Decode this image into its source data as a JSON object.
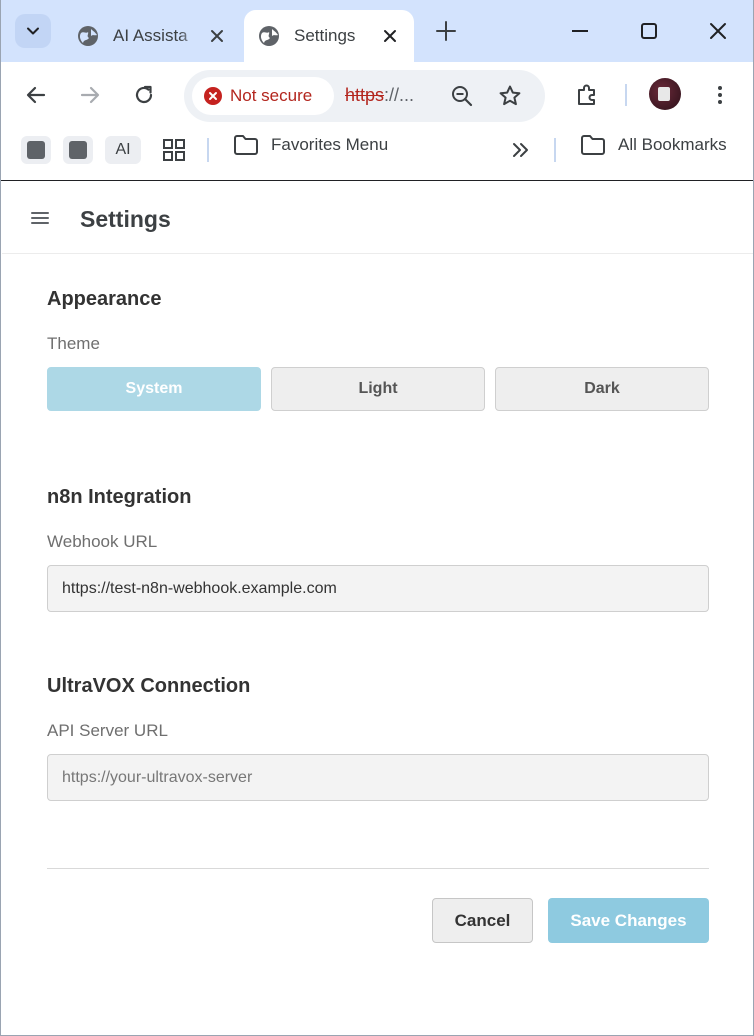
{
  "browser": {
    "tabs": [
      {
        "title": "AI Assista",
        "active": false
      },
      {
        "title": "Settings",
        "active": true
      }
    ],
    "security_label": "Not secure",
    "url_scheme": "https",
    "url_rest": "://...",
    "bookmarks": {
      "chip_ai_label": "AI",
      "favorites_label": "Favorites Menu",
      "all_bookmarks_label": "All Bookmarks"
    },
    "icons": [
      "tab-search-icon",
      "globe-icon",
      "close-icon",
      "plus-icon",
      "minimize-icon",
      "maximize-icon",
      "back-arrow-icon",
      "forward-arrow-icon",
      "reload-icon",
      "zoom-out-icon",
      "star-icon",
      "extensions-icon",
      "more-vert-icon",
      "apps-grid-icon",
      "folder-icon",
      "chevron-double-right-icon"
    ]
  },
  "settings": {
    "header_title": "Settings",
    "appearance": {
      "title": "Appearance",
      "theme_label": "Theme",
      "options": [
        "System",
        "Light",
        "Dark"
      ],
      "selected": "System"
    },
    "n8n": {
      "title": "n8n Integration",
      "webhook_label": "Webhook URL",
      "webhook_value": "https://test-n8n-webhook.example.com"
    },
    "ultravox": {
      "title": "UltraVOX Connection",
      "api_label": "API Server URL",
      "api_value": "",
      "api_placeholder": "https://your-ultravox-server"
    },
    "actions": {
      "cancel_label": "Cancel",
      "save_label": "Save Changes"
    }
  },
  "colors": {
    "tab_strip": "#d3e3fd",
    "selected_theme": "#add8e6",
    "save_button": "#8ecae0",
    "not_secure": "#b3261e"
  }
}
